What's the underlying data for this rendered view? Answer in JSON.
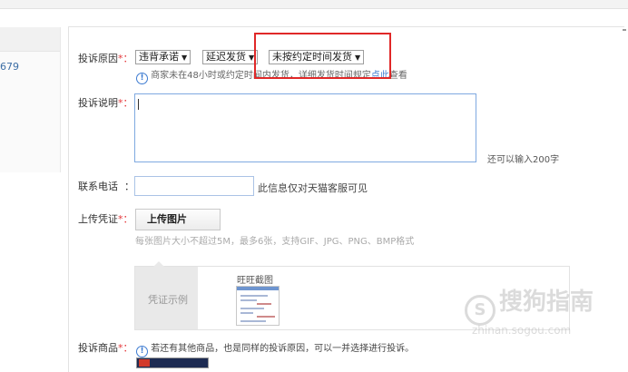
{
  "left_panel": {
    "number_text": "679"
  },
  "form": {
    "reason": {
      "label": "投诉原因",
      "required_mark": "*：",
      "selects": [
        "违背承诺",
        "延迟发货",
        "未按约定时间发货"
      ],
      "hint_before": "商家未在48小时或约定时间内发货，详细发货时间规定",
      "hint_link": "点此",
      "hint_after": "查看"
    },
    "description": {
      "label": "投诉说明",
      "required_mark": "*：",
      "value": "",
      "remaining_text": "还可以输入200字"
    },
    "phone": {
      "label": "联系电话",
      "colon": "：",
      "value": "",
      "visibility_note": "此信息仅对天猫客服可见"
    },
    "evidence": {
      "label": "上传凭证",
      "required_mark": "*：",
      "upload_button": "上传图片",
      "upload_hint": "每张图片大小不超过5M，最多6张，支持GIF、JPG、PNG、BMP格式",
      "sample_tab": "凭证示例",
      "screenshot_title": "旺旺截图"
    },
    "product": {
      "label": "投诉商品",
      "required_mark": "*：",
      "hint": "若还有其他商品，也是同样的投诉原因，可以一并选择进行投诉。"
    }
  },
  "watermark": {
    "text": "搜狗指南",
    "sub": "zhinan.sogou.com"
  },
  "colors": {
    "accent": "#3d7bd1",
    "required": "#e4393c",
    "highlight_box": "#e02828"
  }
}
